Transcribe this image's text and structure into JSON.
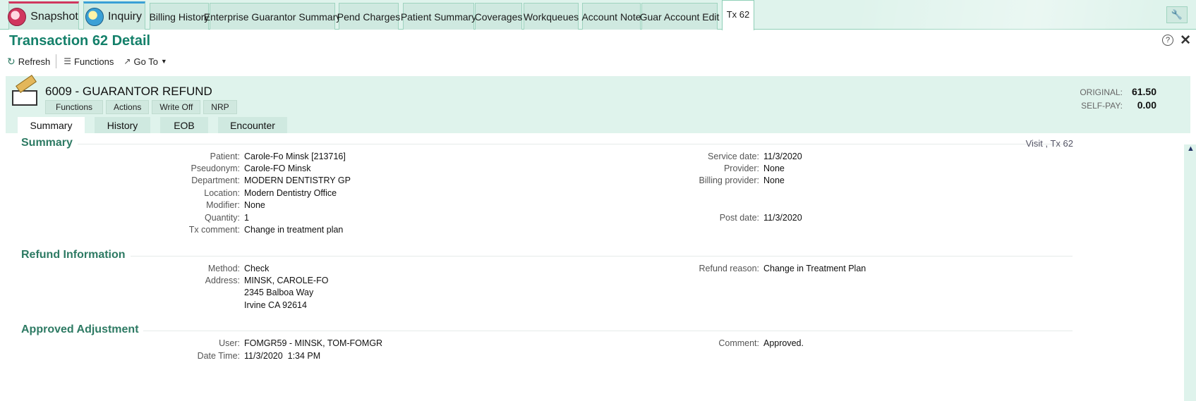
{
  "tabs": [
    {
      "label": "Snapshot"
    },
    {
      "label": "Inquiry"
    },
    {
      "label": "Billing History"
    },
    {
      "label": "Enterprise Guarantor Summary"
    },
    {
      "label": "Pend Charges"
    },
    {
      "label": "Patient Summary"
    },
    {
      "label": "Coverages"
    },
    {
      "label": "Workqueues"
    },
    {
      "label": "Account Note"
    },
    {
      "label": "Guar Account Edit"
    },
    {
      "label": "Tx 62"
    }
  ],
  "page_title": "Transaction 62 Detail",
  "toolbar": {
    "refresh": "Refresh",
    "functions": "Functions",
    "goto": "Go To"
  },
  "transaction": {
    "title": "6009 - GUARANTOR REFUND",
    "buttons": [
      "Functions",
      "Actions",
      "Write Off",
      "NRP"
    ],
    "original_label": "ORIGINAL:",
    "original_value": "61.50",
    "selfpay_label": "SELF-PAY:",
    "selfpay_value": "0.00"
  },
  "subtabs": [
    "Summary",
    "History",
    "EOB",
    "Encounter"
  ],
  "summary": {
    "heading": "Summary",
    "visit_ref": "Visit , Tx 62",
    "left": [
      {
        "label": "Patient:",
        "value": "Carole-Fo Minsk [213716]"
      },
      {
        "label": "Pseudonym:",
        "value": "Carole-FO Minsk"
      },
      {
        "label": "Department:",
        "value": "MODERN DENTISTRY GP"
      },
      {
        "label": "Location:",
        "value": "Modern Dentistry Office"
      },
      {
        "label": "Modifier:",
        "value": "None"
      },
      {
        "label": "Quantity:",
        "value": "1"
      },
      {
        "label": "Tx comment:",
        "value": "Change in treatment plan"
      }
    ],
    "right": [
      {
        "label": "Service date:",
        "value": "11/3/2020"
      },
      {
        "label": "Provider:",
        "value": "None"
      },
      {
        "label": "Billing provider:",
        "value": "None"
      },
      {
        "label": "Post date:",
        "value": "11/3/2020"
      }
    ]
  },
  "refund": {
    "heading": "Refund Information",
    "method_label": "Method:",
    "method": "Check",
    "address_label": "Address:",
    "address": [
      "MINSK, CAROLE-FO",
      "2345 Balboa Way",
      "Irvine CA 92614"
    ],
    "reason_label": "Refund reason:",
    "reason": "Change in Treatment Plan"
  },
  "adjustment": {
    "heading": "Approved Adjustment",
    "user_label": "User:",
    "user": "FOMGR59 - MINSK, TOM-FOMGR",
    "datetime_label": "Date Time:",
    "datetime": "11/3/2020  1:34 PM",
    "comment_label": "Comment:",
    "comment": "Approved."
  },
  "colors": {
    "accent": "#14806a",
    "panel": "#dff3ec",
    "tab": "#cfe9e0"
  }
}
